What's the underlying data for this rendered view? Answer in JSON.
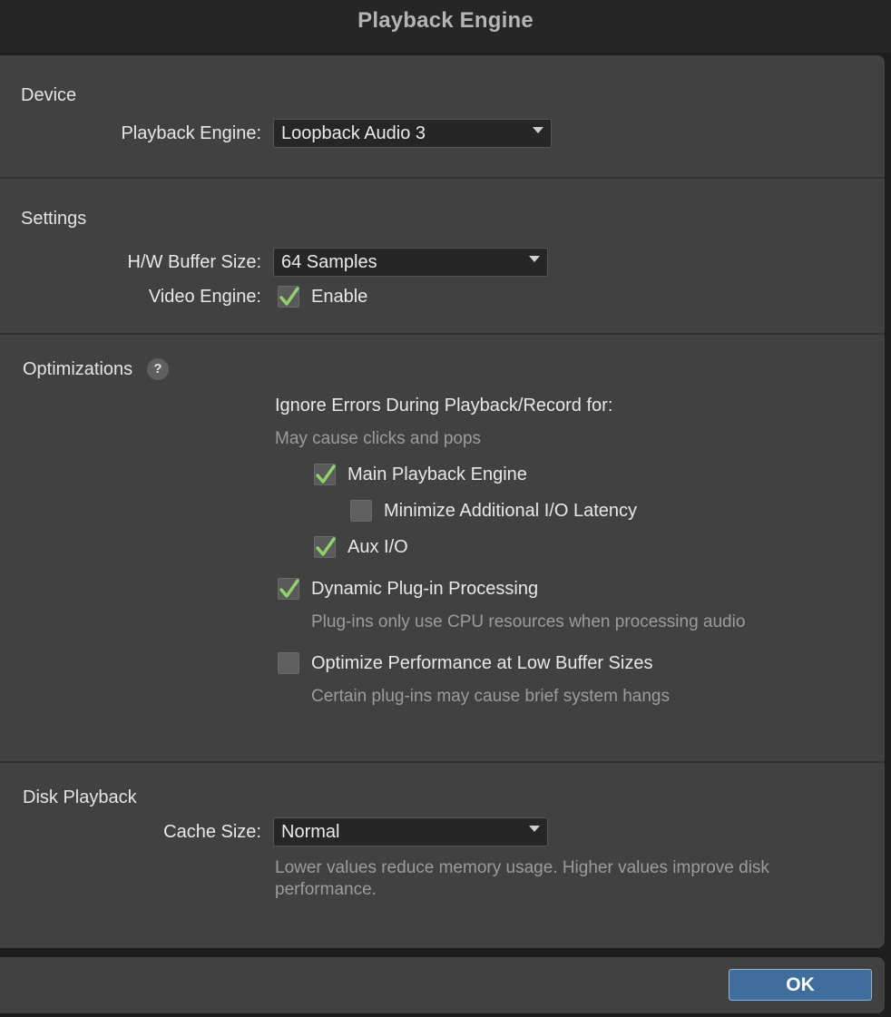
{
  "window": {
    "title": "Playback Engine"
  },
  "device": {
    "section_title": "Device",
    "playback_engine_label": "Playback Engine:",
    "playback_engine_value": "Loopback Audio 3"
  },
  "settings": {
    "section_title": "Settings",
    "buffer_label": "H/W Buffer Size:",
    "buffer_value": "64 Samples",
    "video_label": "Video Engine:",
    "video_enable_label": "Enable",
    "video_enabled": true
  },
  "optimizations": {
    "section_title": "Optimizations",
    "help_glyph": "?",
    "ignore_errors_heading": "Ignore Errors During Playback/Record for:",
    "ignore_errors_hint": "May cause clicks and pops",
    "main_playback_label": "Main Playback Engine",
    "main_playback_checked": true,
    "minimize_latency_label": "Minimize Additional I/O Latency",
    "minimize_latency_checked": false,
    "aux_io_label": "Aux I/O",
    "aux_io_checked": true,
    "dynamic_plugin_label": "Dynamic Plug-in Processing",
    "dynamic_plugin_checked": true,
    "dynamic_plugin_hint": "Plug-ins only use CPU resources when processing audio",
    "optimize_perf_label": "Optimize Performance at Low Buffer Sizes",
    "optimize_perf_checked": false,
    "optimize_perf_hint": "Certain plug-ins may cause brief system hangs"
  },
  "disk_playback": {
    "section_title": "Disk Playback",
    "cache_label": "Cache Size:",
    "cache_value": "Normal",
    "cache_hint_line1": "Lower values reduce memory usage. Higher values improve disk",
    "cache_hint_line2": "performance."
  },
  "footer": {
    "ok_label": "OK"
  },
  "colors": {
    "check": "#8fd36a",
    "ok_button": "#3f6e9c",
    "panel": "#414141",
    "dropdown": "#262626"
  }
}
